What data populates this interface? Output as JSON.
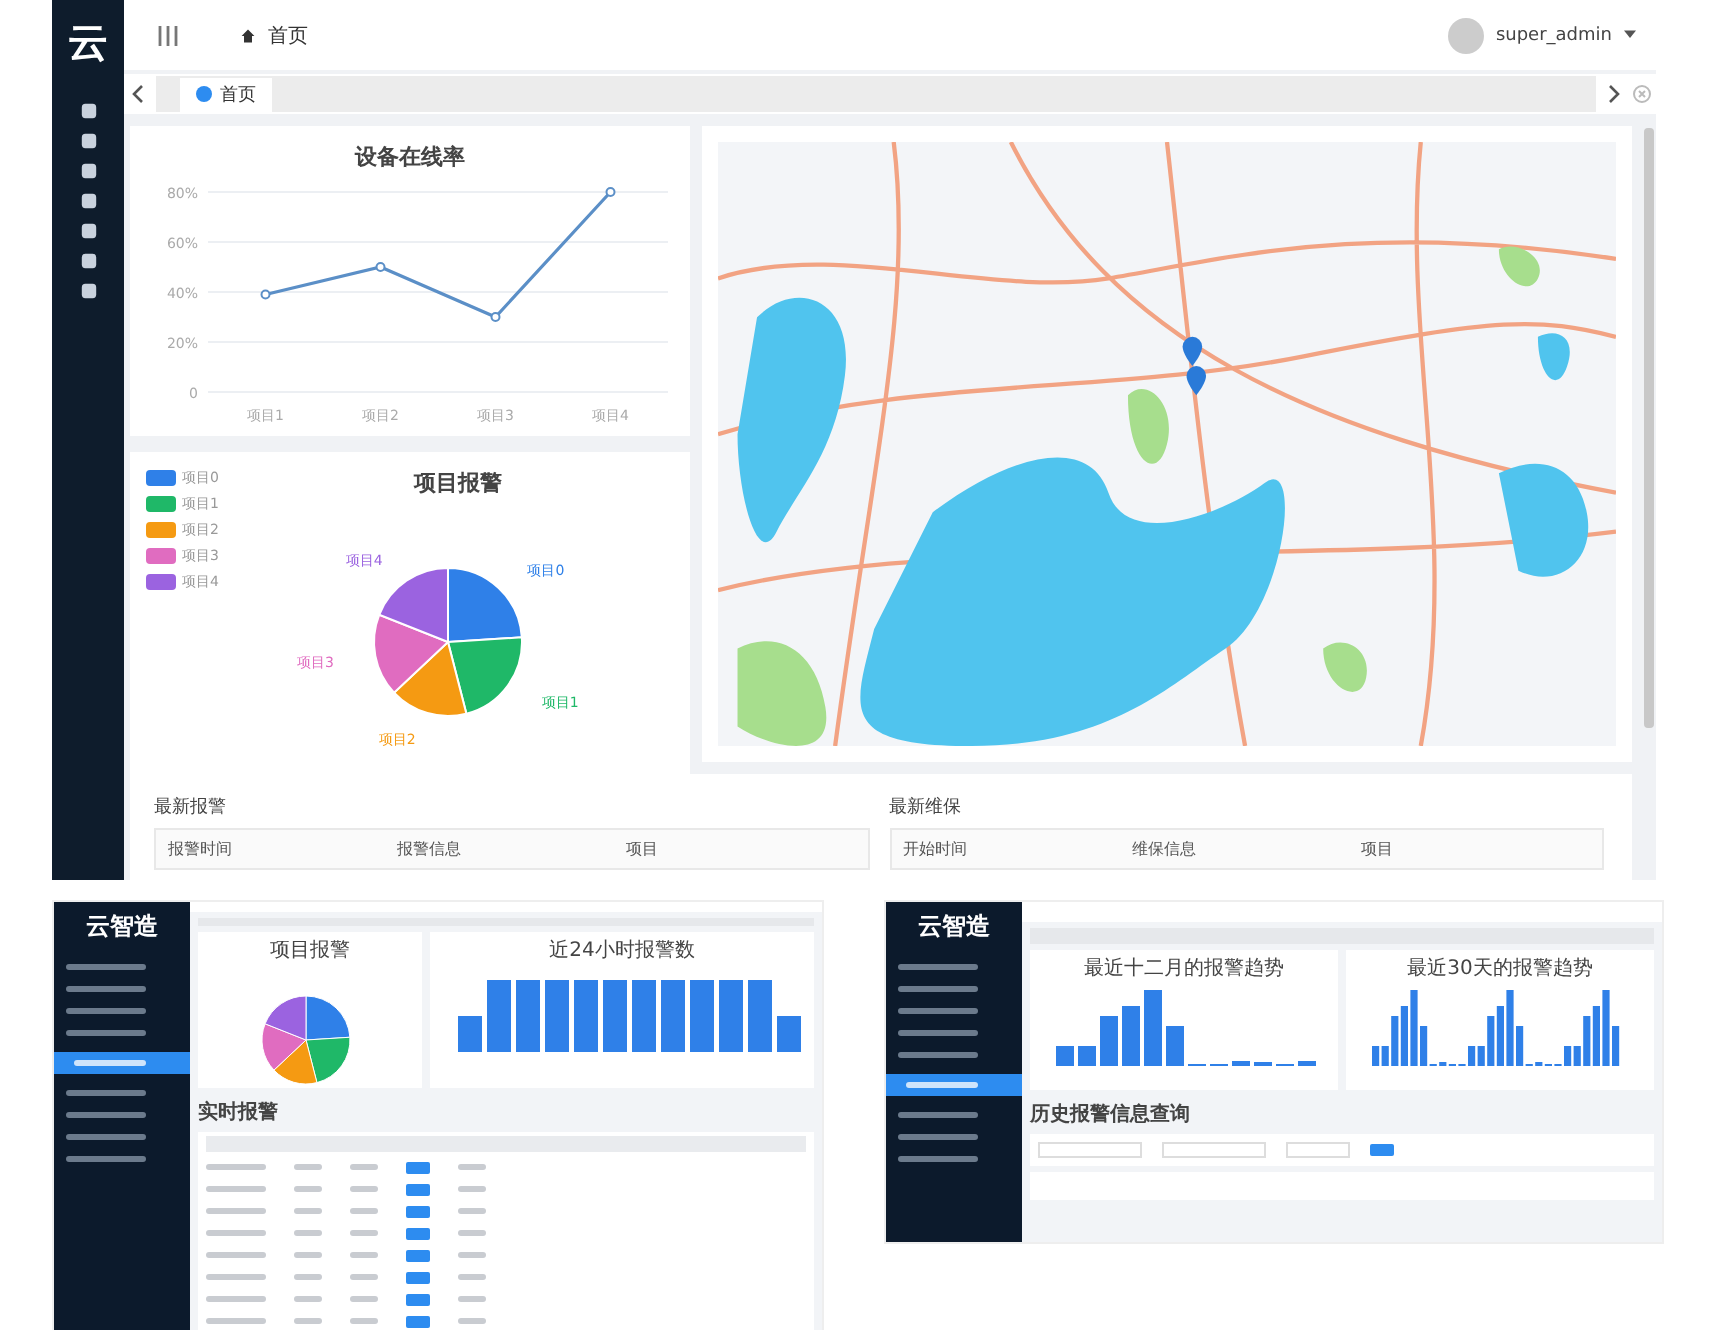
{
  "main": {
    "logo": "云",
    "breadcrumb": "首页",
    "user": "super_admin",
    "tabs": [
      {
        "label": "首页",
        "selected": true
      }
    ],
    "online_card": {
      "chart_data": {
        "type": "line",
        "title": "设备在线率",
        "grid": true,
        "categories": [
          "项目1",
          "项目2",
          "项目3",
          "项目4"
        ],
        "series": [
          {
            "color": "#5b8fc7",
            "marker": true,
            "values": [
              39,
              50,
              30,
              80
            ]
          }
        ],
        "ylim": [
          0,
          80
        ],
        "yticks": [
          {
            "value": 0,
            "label": "0"
          },
          {
            "value": 20,
            "label": "20%"
          },
          {
            "value": 40,
            "label": "40%"
          },
          {
            "value": 60,
            "label": "60%"
          },
          {
            "value": 80,
            "label": "80%"
          }
        ]
      }
    },
    "alarm_card": {
      "title": "项目报警",
      "legend": [
        {
          "label": "项目0",
          "color": "#2f80e8"
        },
        {
          "label": "项目1",
          "color": "#1fb868"
        },
        {
          "label": "项目2",
          "color": "#f59a12"
        },
        {
          "label": "项目3",
          "color": "#e06cc0"
        },
        {
          "label": "项目4",
          "color": "#9b63e0"
        }
      ],
      "slice_labels": [
        "项目0",
        "项目1",
        "项目2",
        "项目3",
        "项目4"
      ]
    },
    "latest_alarms": {
      "title": "最新报警",
      "columns": [
        "报警时间",
        "报警信息",
        "项目"
      ]
    },
    "latest_maintenance": {
      "title": "最新维保",
      "columns": [
        "开始时间",
        "维保信息",
        "项目"
      ]
    }
  },
  "realtime_screen": {
    "logo": "云智造",
    "pie_title": "项目报警",
    "bar_title": "近24小时报警数",
    "table_title": "实时报警"
  },
  "history_screen": {
    "logo": "云智造",
    "month_chart_title": "最近十二月的报警趋势",
    "day_chart_title": "最近30天的报警趋势",
    "query_title": "历史报警信息查询"
  }
}
